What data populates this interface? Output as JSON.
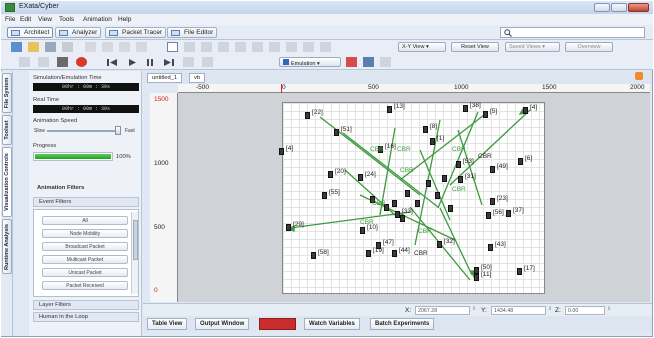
{
  "window": {
    "title": "EXata/Cyber"
  },
  "menu": [
    "File",
    "Edit",
    "View",
    "Tools",
    "Animation",
    "Help"
  ],
  "perspectives": [
    "Architect",
    "Analyzer",
    "Packet Tracer",
    "File Editor"
  ],
  "toolbar": {
    "view_select": "X-Y View",
    "reset_view": "Reset View",
    "saved_views": "Saved Views",
    "overview": "Overview",
    "emulation": "Emulation"
  },
  "side_tabs": [
    "File System",
    "Toolset",
    "Visualization Controls",
    "Runtime Analysis"
  ],
  "panel": {
    "sim_time_label": "Simulation/Emulation Time",
    "sim_time_value": "00hr : 00m : 30s",
    "real_time_label": "Real Time",
    "real_time_value": "00hr : 00m : 30s",
    "anim_speed_label": "Animation Speed",
    "slow": "Slow",
    "fast": "Fast",
    "progress_label": "Progress",
    "progress_value": "100%",
    "progress_fraction": 1.0,
    "filters_title": "Animation Filters",
    "event_filters": "Event Filters",
    "filters": [
      "All",
      "Node Mobility",
      "Broadcast Packet",
      "Multicast Packet",
      "Unicast Packet",
      "Packet Received"
    ],
    "layer_filters": "Layer Filters",
    "human_loop": "Human in the Loop"
  },
  "doc_tabs": [
    "untitled_1",
    "vb"
  ],
  "ruler": {
    "h": [
      "-500",
      "0",
      "500",
      "1000",
      "1500",
      "2000"
    ],
    "v": [
      "1500",
      "1000",
      "500",
      "0"
    ]
  },
  "nodes": [
    {
      "id": "[22]"
    },
    {
      "id": "[13]"
    },
    {
      "id": "[38]"
    },
    {
      "id": "[5]"
    },
    {
      "id": "[4]"
    },
    {
      "id": "[51]"
    },
    {
      "id": "[8]"
    },
    {
      "id": "[1]"
    },
    {
      "id": "[4]"
    },
    {
      "id": "[16]"
    },
    {
      "id": "[53]"
    },
    {
      "id": "[6]"
    },
    {
      "id": "[49]"
    },
    {
      "id": "[20]"
    },
    {
      "id": "[24]"
    },
    {
      "id": "[55]"
    },
    {
      "id": "[31]"
    },
    {
      "id": "[23]"
    },
    {
      "id": "[56]"
    },
    {
      "id": "[37]"
    },
    {
      "id": "[29]"
    },
    {
      "id": "[10]"
    },
    {
      "id": "[33]"
    },
    {
      "id": "[32]"
    },
    {
      "id": "[47]"
    },
    {
      "id": "[58]"
    },
    {
      "id": "[19]"
    },
    {
      "id": "[44]"
    },
    {
      "id": "[43]"
    },
    {
      "id": "[50]"
    },
    {
      "id": "[11]"
    },
    {
      "id": "[17]"
    }
  ],
  "cbr_labels": [
    "CBR",
    "CBR",
    "CBR",
    "CBR",
    "CBR",
    "CBR",
    "CBR",
    "CBR",
    "CBR",
    "CBR"
  ],
  "status": {
    "x_label": "X:",
    "x_value": "2067.28",
    "y_label": "Y:",
    "y_value": "1434.48",
    "z_label": "Z:",
    "z_value": "0.00"
  },
  "bottom_tabs": [
    "Table View",
    "Output Window",
    "Error Log",
    "Watch Variables",
    "Batch Experiments"
  ],
  "colors": {
    "link": "#3e9a3e",
    "progress": "#2fae2f",
    "error_tab": "#c92d2d"
  }
}
